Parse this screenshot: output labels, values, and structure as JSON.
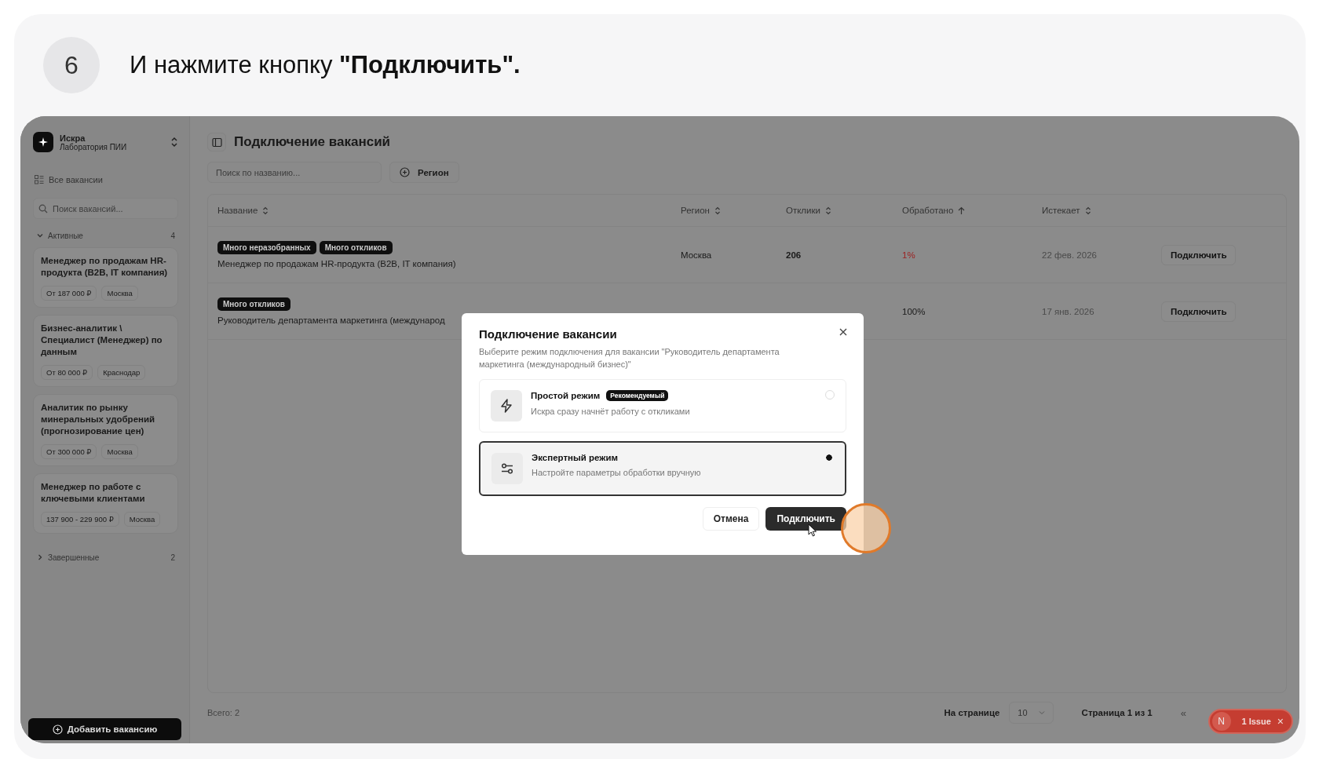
{
  "step": {
    "number": "6",
    "text": "И нажмите кнопку **\"Подключить\".**"
  },
  "sidebar": {
    "org_name": "Искра",
    "org_subtitle": "Лаборатория ПИИ",
    "all_vacancies": "Все вакансии",
    "search_placeholder": "Поиск вакансий...",
    "groups": [
      {
        "label": "Активные",
        "count": "4",
        "expanded": true,
        "items": [
          {
            "title": "Менеджер по продажам HR-продукта (B2B, IT компания)",
            "salary": "От 187 000 ₽",
            "city": "Москва"
          },
          {
            "title": "Бизнес-аналитик \\ Специалист (Менеджер) по данным",
            "salary": "От 80 000 ₽",
            "city": "Краснодар"
          },
          {
            "title": "Аналитик по рынку минеральных удобрений (прогнозирование цен)",
            "salary": "От 300 000 ₽",
            "city": "Москва"
          },
          {
            "title": "Менеджер по работе с ключевыми клиентами",
            "salary": "137 900 - 229 900 ₽",
            "city": "Москва"
          }
        ]
      },
      {
        "label": "Завершенные",
        "count": "2",
        "expanded": false
      }
    ],
    "add_button": "Добавить вакансию"
  },
  "page": {
    "title": "Подключение вакансий",
    "search_placeholder": "Поиск по названию...",
    "filter": "Регион"
  },
  "table": {
    "columns": [
      {
        "label": "Название",
        "sorted": false
      },
      {
        "label": "Регион",
        "sorted": false
      },
      {
        "label": "Отклики",
        "sorted": false
      },
      {
        "label": "Обработано",
        "sorted": true
      },
      {
        "label": "Истекает",
        "sorted": false
      }
    ],
    "rows": [
      {
        "tags": [
          "Много неразобранных",
          "Много откликов"
        ],
        "title": "Менеджер по продажам HR-продукта (B2B, IT компания)",
        "region": "Москва",
        "responses": "206",
        "processed": "1%",
        "warning": true,
        "expires": "22 фев. 2026",
        "action": "Подключить"
      },
      {
        "tags": [
          "Много откликов"
        ],
        "title": "Руководитель департамента маркетинга (международ",
        "processed": "100%",
        "warning": false,
        "expires": "17 янв. 2026",
        "action": "Подключить"
      }
    ]
  },
  "footer": {
    "total": "Всего: 2",
    "per_page_label": "На странице",
    "per_page": "10",
    "page_info": "Страница 1 из 1",
    "first_page": "«"
  },
  "issue_badge": {
    "avatar": "N",
    "label": "1 Issue",
    "close": "×"
  },
  "modal": {
    "title": "Подключение вакансии",
    "description": "Выберите режим подключения для вакансии \"Руководитель департамента маркетинга (международный бизнес)\"",
    "options": [
      {
        "kind": "simple",
        "title": "Простой режим",
        "badge": "Рекомендуемый",
        "description": "Искра сразу начнёт работу с откликами",
        "selected": false
      },
      {
        "kind": "expert",
        "title": "Экспертный режим",
        "description": "Настройте параметры обработки вручную",
        "selected": true
      }
    ],
    "cancel": "Отмена",
    "confirm": "Подключить"
  }
}
